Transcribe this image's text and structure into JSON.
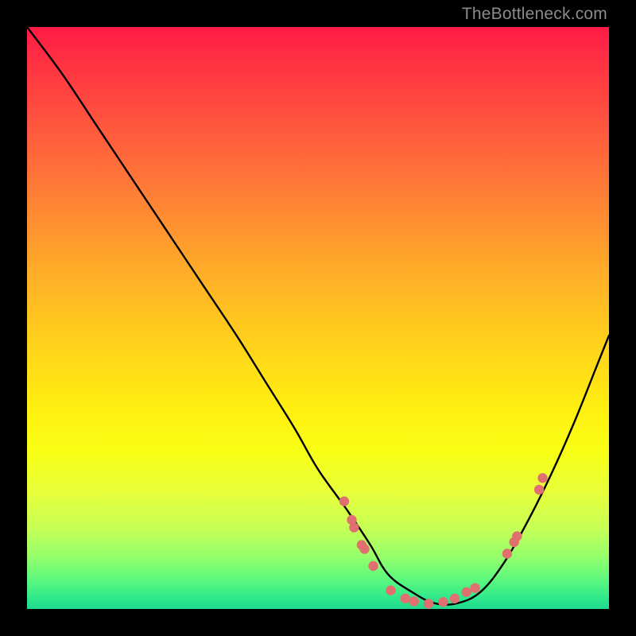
{
  "watermark": "TheBottleneck.com",
  "chart_data": {
    "type": "line",
    "title": "",
    "xlabel": "",
    "ylabel": "",
    "xlim": [
      0,
      100
    ],
    "ylim": [
      0,
      100
    ],
    "curve": {
      "name": "bottleneck-curve",
      "x": [
        0,
        6,
        12,
        18,
        24,
        30,
        36,
        41,
        46,
        50,
        55,
        59,
        62,
        66,
        70,
        74,
        78,
        82,
        86,
        90,
        94,
        98,
        100
      ],
      "y": [
        100,
        92,
        83,
        74,
        65,
        56,
        47,
        39,
        31,
        24,
        17,
        11,
        6,
        3,
        1,
        1,
        3,
        8,
        15,
        23,
        32,
        42,
        47
      ]
    },
    "markers": {
      "name": "fit-points",
      "color": "#e0706f",
      "radius": 6.2,
      "points": [
        {
          "x": 54.5,
          "y": 18.5
        },
        {
          "x": 55.8,
          "y": 15.3
        },
        {
          "x": 56.2,
          "y": 14.0
        },
        {
          "x": 57.5,
          "y": 11.0
        },
        {
          "x": 58.0,
          "y": 10.3
        },
        {
          "x": 59.5,
          "y": 7.4
        },
        {
          "x": 62.5,
          "y": 3.2
        },
        {
          "x": 65.0,
          "y": 1.8
        },
        {
          "x": 66.5,
          "y": 1.3
        },
        {
          "x": 69.0,
          "y": 0.9
        },
        {
          "x": 71.5,
          "y": 1.2
        },
        {
          "x": 73.5,
          "y": 1.8
        },
        {
          "x": 75.5,
          "y": 2.9
        },
        {
          "x": 77.0,
          "y": 3.6
        },
        {
          "x": 82.5,
          "y": 9.5
        },
        {
          "x": 83.7,
          "y": 11.5
        },
        {
          "x": 84.2,
          "y": 12.5
        },
        {
          "x": 88.0,
          "y": 20.5
        },
        {
          "x": 88.6,
          "y": 22.5
        }
      ]
    },
    "gradient_stops": [
      {
        "pos": 0,
        "color": "#ff1a47"
      },
      {
        "pos": 32,
        "color": "#ff8a33"
      },
      {
        "pos": 56,
        "color": "#ffd61a"
      },
      {
        "pos": 80,
        "color": "#e7ff3b"
      },
      {
        "pos": 100,
        "color": "#1fd98e"
      }
    ]
  }
}
